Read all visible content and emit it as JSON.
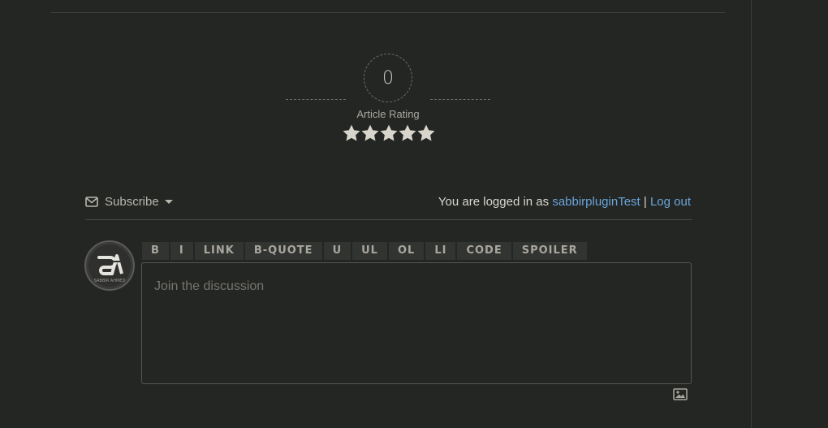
{
  "rating": {
    "value": "0",
    "label": "Article Rating",
    "stars_total": 5,
    "stars_filled": 5,
    "star_color": "#d8d5cc"
  },
  "comments": {
    "subscribe_label": "Subscribe",
    "logged_in_prefix": "You are logged in as ",
    "username": "sabbirpluginTest",
    "separator": " | ",
    "logout_label": "Log out",
    "avatar_text": "SABBIR AHMED"
  },
  "toolbar": {
    "buttons": [
      "B",
      "I",
      "LINK",
      "B-QUOTE",
      "U",
      "UL",
      "OL",
      "LI",
      "CODE",
      "SPOILER"
    ]
  },
  "editor": {
    "placeholder": "Join the discussion"
  },
  "colors": {
    "background": "#242624",
    "link": "#6aa4d9",
    "text": "#c9c7c0"
  },
  "icons": {
    "subscribe": "envelope-icon",
    "dropdown": "caret-down-icon",
    "image_upload": "image-icon",
    "star": "star-icon"
  }
}
